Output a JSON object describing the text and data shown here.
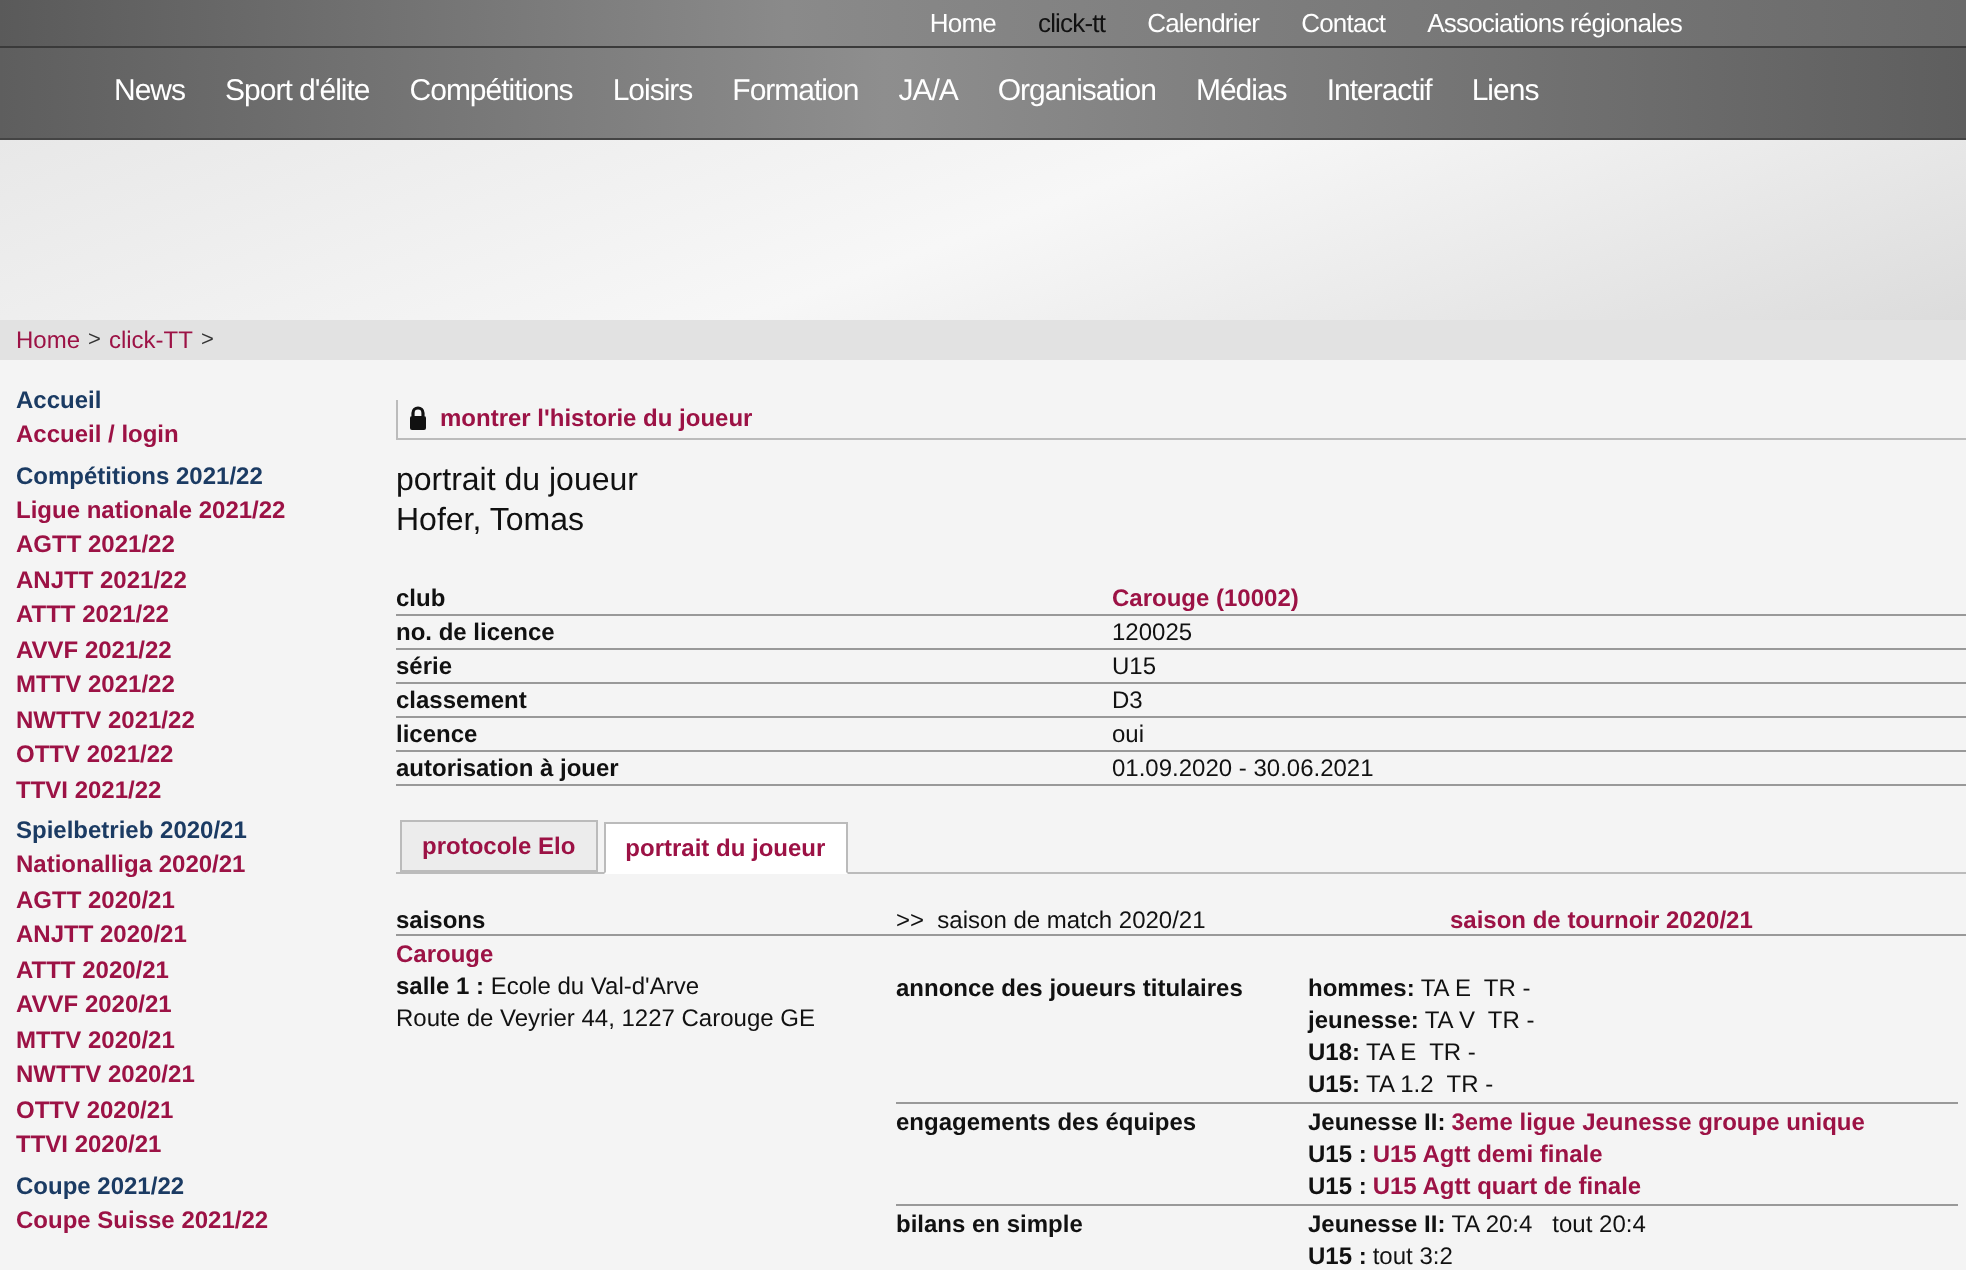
{
  "top_menu": [
    {
      "label": "Home",
      "selected": false
    },
    {
      "label": "click-tt",
      "selected": true
    },
    {
      "label": "Calendrier",
      "selected": false
    },
    {
      "label": "Contact",
      "selected": false
    },
    {
      "label": "Associations régionales",
      "selected": false
    }
  ],
  "main_menu": [
    "News",
    "Sport d'élite",
    "Compétitions",
    "Loisirs",
    "Formation",
    "JA/A",
    "Organisation",
    "Médias",
    "Interactif",
    "Liens"
  ],
  "breadcrumb": [
    "Home",
    "click-TT"
  ],
  "breadcrumb_separator": ">",
  "sidebar": [
    {
      "heading": "Accueil",
      "items": [
        "Accueil / login"
      ]
    },
    {
      "heading": "Compétitions 2021/22",
      "items": [
        "Ligue nationale 2021/22",
        "AGTT 2021/22",
        "ANJTT 2021/22",
        "ATTT 2021/22",
        "AVVF 2021/22",
        "MTTV 2021/22",
        "NWTTV 2021/22",
        "OTTV 2021/22",
        "TTVI 2021/22"
      ]
    },
    {
      "heading": "Spielbetrieb 2020/21",
      "items": [
        "Nationalliga 2020/21",
        "AGTT 2020/21",
        "ANJTT 2020/21",
        "ATTT 2020/21",
        "AVVF 2020/21",
        "MTTV 2020/21",
        "NWTTV 2020/21",
        "OTTV 2020/21",
        "TTVI 2020/21"
      ]
    },
    {
      "heading": "Coupe 2021/22",
      "items": [
        "Coupe Suisse 2021/22"
      ]
    }
  ],
  "history_link": "montrer l'historie du joueur",
  "page_title": "portrait du joueur",
  "player_name": "Hofer, Tomas",
  "details": [
    {
      "label": "club",
      "value": "Carouge (10002)",
      "kind": "link"
    },
    {
      "label": "no. de licence",
      "value": "120025",
      "kind": "plain"
    },
    {
      "label": "série",
      "value": "U15",
      "kind": "plain"
    },
    {
      "label": "classement",
      "value": "D3",
      "kind": "plain"
    },
    {
      "label": "licence",
      "value": "oui",
      "kind": "plain"
    },
    {
      "label": "autorisation à jouer",
      "value": "01.09.2020 - 30.06.2021",
      "kind": "plain"
    }
  ],
  "tabs": [
    {
      "label": "protocole Elo",
      "selected": false
    },
    {
      "label": "portrait du joueur",
      "selected": true
    }
  ],
  "seasons": {
    "label": "saisons",
    "match_season": ">>  saison de match 2020/21",
    "tournament_season": "saison de tournoir 2020/21"
  },
  "club": {
    "name": "Carouge",
    "hall_label": "salle 1 :",
    "hall_name": "Ecole du Val-d'Arve",
    "address": "Route de Veyrier 44, 1227 Carouge GE"
  },
  "sections": [
    {
      "label": "annonce des joueurs titulaires",
      "lines": [
        {
          "label": "hommes:",
          "text": "TA E  TR -",
          "kind": "plain"
        },
        {
          "label": "jeunesse:",
          "text": "TA V  TR -",
          "kind": "plain"
        },
        {
          "label": "U18:",
          "text": "TA E  TR -",
          "kind": "plain"
        },
        {
          "label": "U15:",
          "text": "TA 1.2  TR -",
          "kind": "plain"
        }
      ]
    },
    {
      "label": "engagements des équipes",
      "lines": [
        {
          "label": "Jeunesse II:",
          "text": "3eme ligue Jeunesse groupe unique",
          "kind": "link"
        },
        {
          "label": "U15 :",
          "text": "U15 Agtt demi finale",
          "kind": "link"
        },
        {
          "label": "U15 :",
          "text": "U15 Agtt quart de finale",
          "kind": "link"
        }
      ]
    },
    {
      "label": "bilans en simple",
      "lines": [
        {
          "label": "Jeunesse II:",
          "text": "TA 20:4   tout 20:4",
          "kind": "plain"
        },
        {
          "label": "U15 :",
          "text": "tout 3:2",
          "kind": "plain"
        }
      ]
    }
  ]
}
